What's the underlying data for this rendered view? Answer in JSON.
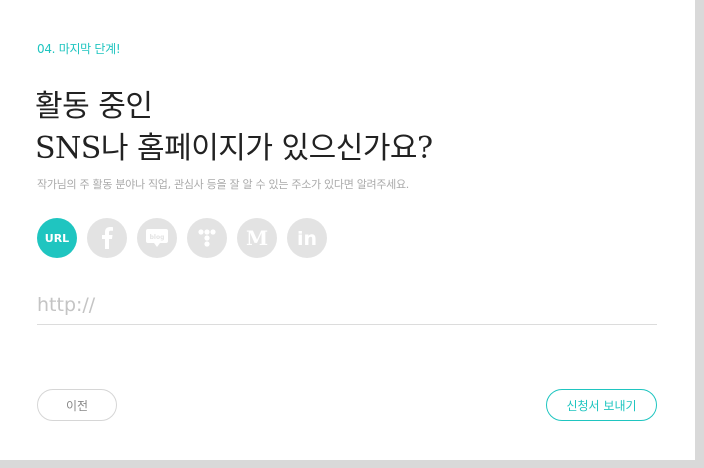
{
  "step_label": "04. 마지막 단계!",
  "title_line1": "활동 중인",
  "title_line2": "SNS나 홈페이지가 있으신가요?",
  "subtitle": "작가님의 주 활동 분야나 직업, 관심사 등을 잘 알 수 있는 주소가 있다면 알려주세요.",
  "sns_options": [
    {
      "label": "URL",
      "icon": "url-icon",
      "selected": true
    },
    {
      "label": "",
      "icon": "facebook-icon",
      "selected": false
    },
    {
      "label": "blog",
      "icon": "blog-icon",
      "selected": false
    },
    {
      "label": "",
      "icon": "tumblr-dots-icon",
      "selected": false
    },
    {
      "label": "M",
      "icon": "medium-icon",
      "selected": false
    },
    {
      "label": "in",
      "icon": "linkedin-icon",
      "selected": false
    }
  ],
  "url_input": {
    "placeholder": "http://",
    "value": ""
  },
  "buttons": {
    "prev": "이전",
    "send": "신청서 보내기"
  },
  "colors": {
    "accent": "#1fc5c0",
    "icon_bg": "#e3e3e3"
  }
}
